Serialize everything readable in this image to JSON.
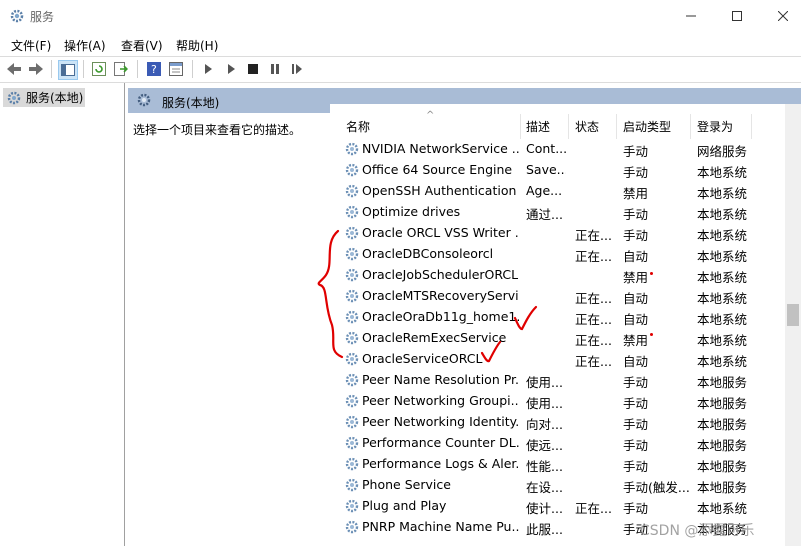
{
  "window": {
    "title": "服务"
  },
  "menu": [
    "文件(F)",
    "操作(A)",
    "查看(V)",
    "帮助(H)"
  ],
  "tree": {
    "item": "服务(本地)"
  },
  "panel": {
    "title": "服务(本地)",
    "description": "选择一个项目来查看它的描述。"
  },
  "columns": {
    "name": "名称",
    "desc": "描述",
    "state": "状态",
    "startup": "启动类型",
    "logon": "登录为"
  },
  "services": [
    {
      "name": "NVIDIA NetworkService ...",
      "desc": "Cont...",
      "state": "",
      "startup": "手动",
      "logon": "网络服务"
    },
    {
      "name": "Office 64 Source Engine",
      "desc": "Save...",
      "state": "",
      "startup": "手动",
      "logon": "本地系统"
    },
    {
      "name": "OpenSSH Authentication ...",
      "desc": "Age...",
      "state": "",
      "startup": "禁用",
      "logon": "本地系统"
    },
    {
      "name": "Optimize drives",
      "desc": "通过...",
      "state": "",
      "startup": "手动",
      "logon": "本地系统"
    },
    {
      "name": "Oracle ORCL VSS Writer ...",
      "desc": "",
      "state": "正在...",
      "startup": "手动",
      "logon": "本地系统"
    },
    {
      "name": "OracleDBConsoleorcl",
      "desc": "",
      "state": "正在...",
      "startup": "自动",
      "logon": "本地系统"
    },
    {
      "name": "OracleJobSchedulerORCL",
      "desc": "",
      "state": "",
      "startup": "禁用",
      "logon": "本地系统"
    },
    {
      "name": "OracleMTSRecoveryServi...",
      "desc": "",
      "state": "正在...",
      "startup": "自动",
      "logon": "本地系统"
    },
    {
      "name": "OracleOraDb11g_home1...",
      "desc": "",
      "state": "正在...",
      "startup": "自动",
      "logon": "本地系统"
    },
    {
      "name": "OracleRemExecService",
      "desc": "",
      "state": "正在...",
      "startup": "禁用",
      "logon": "本地系统"
    },
    {
      "name": "OracleServiceORCL",
      "desc": "",
      "state": "正在...",
      "startup": "自动",
      "logon": "本地系统"
    },
    {
      "name": "Peer Name Resolution Pr...",
      "desc": "使用...",
      "state": "",
      "startup": "手动",
      "logon": "本地服务"
    },
    {
      "name": "Peer Networking Groupi...",
      "desc": "使用...",
      "state": "",
      "startup": "手动",
      "logon": "本地服务"
    },
    {
      "name": "Peer Networking Identity...",
      "desc": "向对...",
      "state": "",
      "startup": "手动",
      "logon": "本地服务"
    },
    {
      "name": "Performance Counter DL...",
      "desc": "使远...",
      "state": "",
      "startup": "手动",
      "logon": "本地服务"
    },
    {
      "name": "Performance Logs & Aler...",
      "desc": "性能...",
      "state": "",
      "startup": "手动",
      "logon": "本地服务"
    },
    {
      "name": "Phone Service",
      "desc": "在设...",
      "state": "",
      "startup": "手动(触发...",
      "logon": "本地服务"
    },
    {
      "name": "Plug and Play",
      "desc": "使计...",
      "state": "正在...",
      "startup": "手动",
      "logon": "本地系统"
    },
    {
      "name": "PNRP Machine Name Pu...",
      "desc": "此服...",
      "state": "",
      "startup": "手动",
      "logon": "本地服务"
    }
  ],
  "watermark": "CSDN @添露可乐",
  "colors": {
    "header": "#a9bcd6",
    "selected": "#d9d9d9",
    "annotation": "#e00000"
  },
  "icons": [
    "gear-icon",
    "back-icon",
    "forward-icon",
    "play-icon",
    "stop-icon",
    "pause-icon"
  ]
}
